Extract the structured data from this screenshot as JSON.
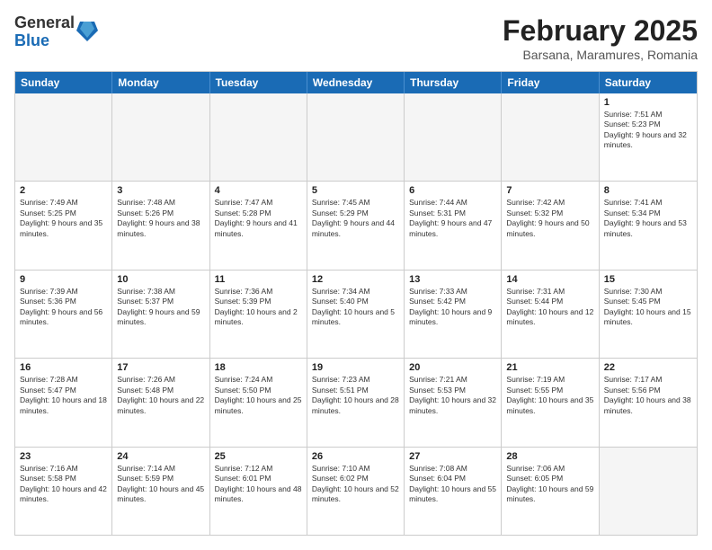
{
  "logo": {
    "general": "General",
    "blue": "Blue"
  },
  "title": "February 2025",
  "location": "Barsana, Maramures, Romania",
  "days_of_week": [
    "Sunday",
    "Monday",
    "Tuesday",
    "Wednesday",
    "Thursday",
    "Friday",
    "Saturday"
  ],
  "weeks": [
    [
      {
        "day": "",
        "text": "",
        "empty": true
      },
      {
        "day": "",
        "text": "",
        "empty": true
      },
      {
        "day": "",
        "text": "",
        "empty": true
      },
      {
        "day": "",
        "text": "",
        "empty": true
      },
      {
        "day": "",
        "text": "",
        "empty": true
      },
      {
        "day": "",
        "text": "",
        "empty": true
      },
      {
        "day": "1",
        "text": "Sunrise: 7:51 AM\nSunset: 5:23 PM\nDaylight: 9 hours and 32 minutes.",
        "empty": false
      }
    ],
    [
      {
        "day": "2",
        "text": "Sunrise: 7:49 AM\nSunset: 5:25 PM\nDaylight: 9 hours and 35 minutes.",
        "empty": false
      },
      {
        "day": "3",
        "text": "Sunrise: 7:48 AM\nSunset: 5:26 PM\nDaylight: 9 hours and 38 minutes.",
        "empty": false
      },
      {
        "day": "4",
        "text": "Sunrise: 7:47 AM\nSunset: 5:28 PM\nDaylight: 9 hours and 41 minutes.",
        "empty": false
      },
      {
        "day": "5",
        "text": "Sunrise: 7:45 AM\nSunset: 5:29 PM\nDaylight: 9 hours and 44 minutes.",
        "empty": false
      },
      {
        "day": "6",
        "text": "Sunrise: 7:44 AM\nSunset: 5:31 PM\nDaylight: 9 hours and 47 minutes.",
        "empty": false
      },
      {
        "day": "7",
        "text": "Sunrise: 7:42 AM\nSunset: 5:32 PM\nDaylight: 9 hours and 50 minutes.",
        "empty": false
      },
      {
        "day": "8",
        "text": "Sunrise: 7:41 AM\nSunset: 5:34 PM\nDaylight: 9 hours and 53 minutes.",
        "empty": false
      }
    ],
    [
      {
        "day": "9",
        "text": "Sunrise: 7:39 AM\nSunset: 5:36 PM\nDaylight: 9 hours and 56 minutes.",
        "empty": false
      },
      {
        "day": "10",
        "text": "Sunrise: 7:38 AM\nSunset: 5:37 PM\nDaylight: 9 hours and 59 minutes.",
        "empty": false
      },
      {
        "day": "11",
        "text": "Sunrise: 7:36 AM\nSunset: 5:39 PM\nDaylight: 10 hours and 2 minutes.",
        "empty": false
      },
      {
        "day": "12",
        "text": "Sunrise: 7:34 AM\nSunset: 5:40 PM\nDaylight: 10 hours and 5 minutes.",
        "empty": false
      },
      {
        "day": "13",
        "text": "Sunrise: 7:33 AM\nSunset: 5:42 PM\nDaylight: 10 hours and 9 minutes.",
        "empty": false
      },
      {
        "day": "14",
        "text": "Sunrise: 7:31 AM\nSunset: 5:44 PM\nDaylight: 10 hours and 12 minutes.",
        "empty": false
      },
      {
        "day": "15",
        "text": "Sunrise: 7:30 AM\nSunset: 5:45 PM\nDaylight: 10 hours and 15 minutes.",
        "empty": false
      }
    ],
    [
      {
        "day": "16",
        "text": "Sunrise: 7:28 AM\nSunset: 5:47 PM\nDaylight: 10 hours and 18 minutes.",
        "empty": false
      },
      {
        "day": "17",
        "text": "Sunrise: 7:26 AM\nSunset: 5:48 PM\nDaylight: 10 hours and 22 minutes.",
        "empty": false
      },
      {
        "day": "18",
        "text": "Sunrise: 7:24 AM\nSunset: 5:50 PM\nDaylight: 10 hours and 25 minutes.",
        "empty": false
      },
      {
        "day": "19",
        "text": "Sunrise: 7:23 AM\nSunset: 5:51 PM\nDaylight: 10 hours and 28 minutes.",
        "empty": false
      },
      {
        "day": "20",
        "text": "Sunrise: 7:21 AM\nSunset: 5:53 PM\nDaylight: 10 hours and 32 minutes.",
        "empty": false
      },
      {
        "day": "21",
        "text": "Sunrise: 7:19 AM\nSunset: 5:55 PM\nDaylight: 10 hours and 35 minutes.",
        "empty": false
      },
      {
        "day": "22",
        "text": "Sunrise: 7:17 AM\nSunset: 5:56 PM\nDaylight: 10 hours and 38 minutes.",
        "empty": false
      }
    ],
    [
      {
        "day": "23",
        "text": "Sunrise: 7:16 AM\nSunset: 5:58 PM\nDaylight: 10 hours and 42 minutes.",
        "empty": false
      },
      {
        "day": "24",
        "text": "Sunrise: 7:14 AM\nSunset: 5:59 PM\nDaylight: 10 hours and 45 minutes.",
        "empty": false
      },
      {
        "day": "25",
        "text": "Sunrise: 7:12 AM\nSunset: 6:01 PM\nDaylight: 10 hours and 48 minutes.",
        "empty": false
      },
      {
        "day": "26",
        "text": "Sunrise: 7:10 AM\nSunset: 6:02 PM\nDaylight: 10 hours and 52 minutes.",
        "empty": false
      },
      {
        "day": "27",
        "text": "Sunrise: 7:08 AM\nSunset: 6:04 PM\nDaylight: 10 hours and 55 minutes.",
        "empty": false
      },
      {
        "day": "28",
        "text": "Sunrise: 7:06 AM\nSunset: 6:05 PM\nDaylight: 10 hours and 59 minutes.",
        "empty": false
      },
      {
        "day": "",
        "text": "",
        "empty": true
      }
    ]
  ]
}
